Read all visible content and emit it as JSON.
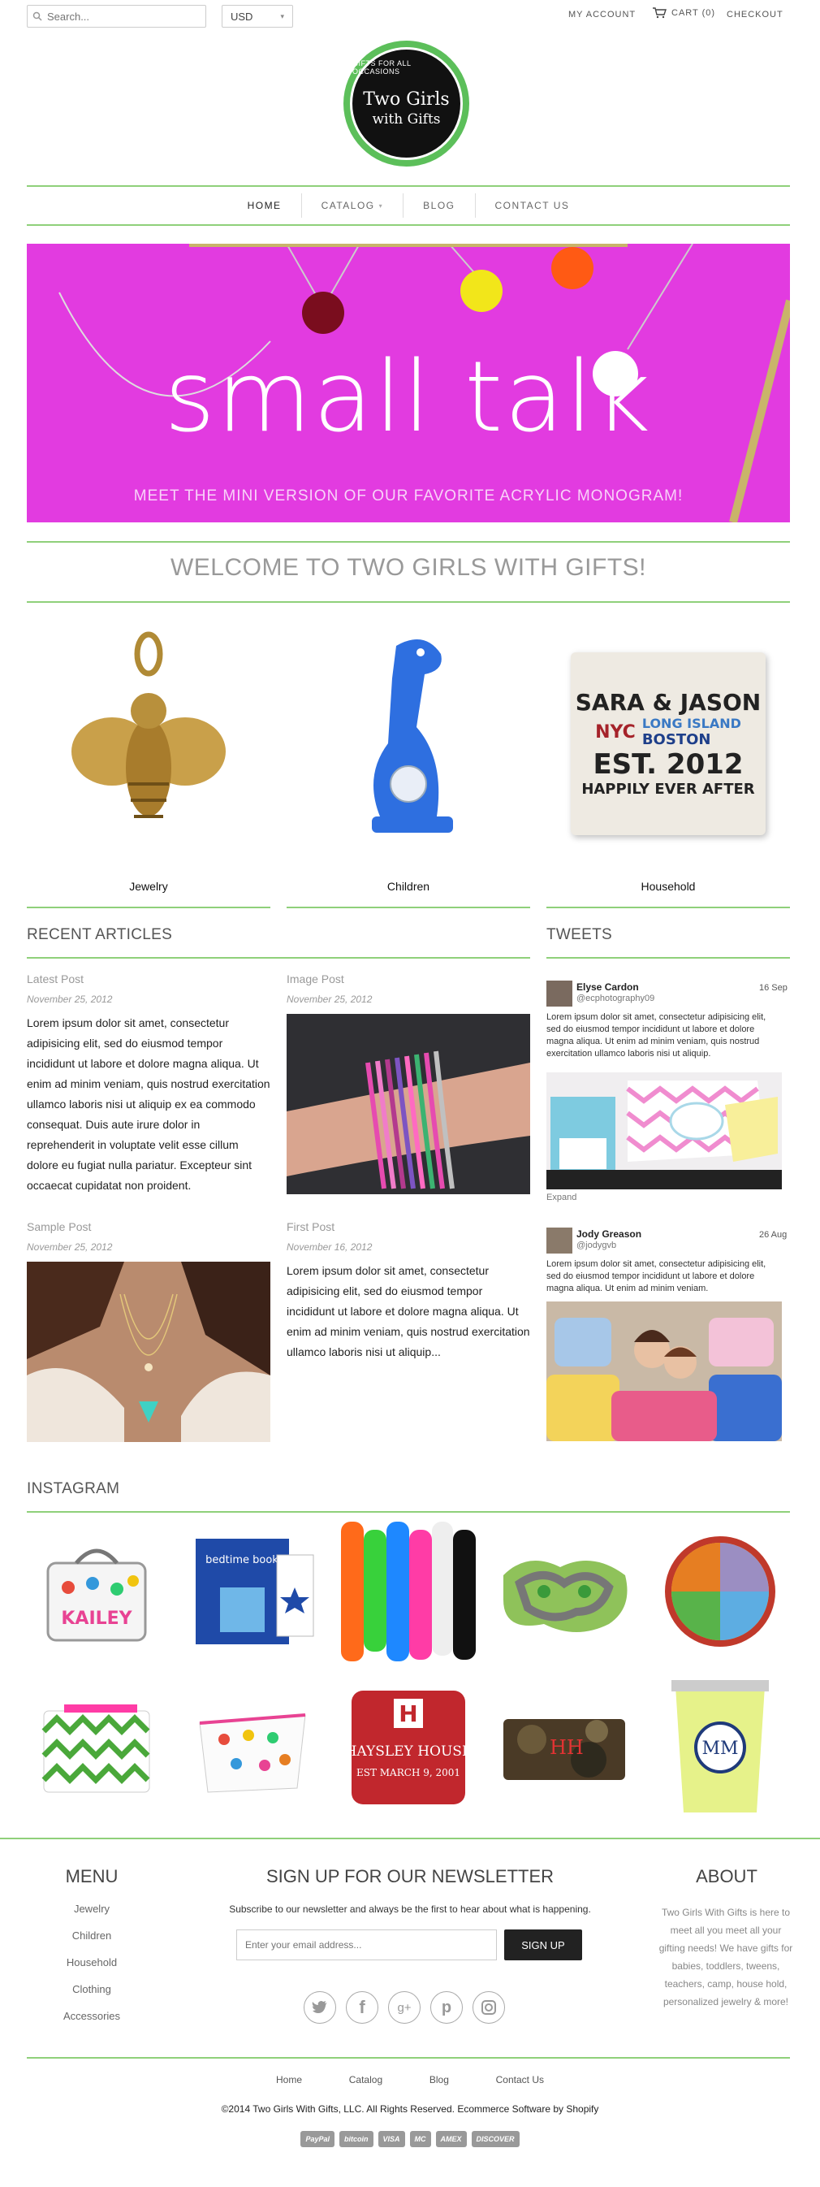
{
  "header": {
    "search_placeholder": "Search...",
    "currency": "USD",
    "my_account": "MY ACCOUNT",
    "cart": "CART (0)",
    "checkout": "CHECKOUT"
  },
  "logo": {
    "tagline": "GIFTS FOR ALL OCCASIONS",
    "name_line1": "Two Girls",
    "name_line2": "with Gifts"
  },
  "nav": {
    "home": "HOME",
    "catalog": "CATALOG",
    "blog": "BLOG",
    "contact": "CONTACT US"
  },
  "hero": {
    "title": "small talk",
    "subtitle": "MEET THE MINI VERSION OF OUR FAVORITE ACRYLIC MONOGRAM!"
  },
  "welcome": "WELCOME TO TWO GIRLS WITH GIFTS!",
  "categories": [
    {
      "label": "Jewelry",
      "icon": "bee-pendant"
    },
    {
      "label": "Children",
      "icon": "blue-giraffe-clock"
    },
    {
      "label": "Household",
      "icon": "pillow"
    }
  ],
  "pillow_text": {
    "l1": "SARA & JASON",
    "l2": "LONG ISLAND",
    "l3": "BOSTON",
    "l4": "EST. 2012",
    "l5": "HAPPILY EVER AFTER",
    "nyc": "NYC"
  },
  "recent_articles": {
    "title": "RECENT ARTICLES",
    "posts": [
      {
        "label": "Latest Post",
        "date": "November 25, 2012",
        "body": "Lorem ipsum dolor sit amet, consectetur adipisicing elit, sed do eiusmod tempor incididunt ut labore et dolore magna aliqua. Ut enim ad minim veniam, quis nostrud exercitation ullamco laboris nisi ut aliquip ex ea commodo consequat. Duis aute irure dolor in reprehenderit in voluptate velit esse cillum dolore eu fugiat nulla pariatur. Excepteur sint occaecat cupidatat non proident."
      },
      {
        "label": "Image Post",
        "date": "November 25, 2012"
      },
      {
        "label": "Sample Post",
        "date": "November 25, 2012"
      },
      {
        "label": "First Post",
        "date": "November 16, 2012",
        "body": "Lorem ipsum dolor sit amet, consectetur adipisicing elit, sed do eiusmod tempor incididunt ut labore et dolore magna aliqua. Ut enim ad minim veniam, quis nostrud exercitation ullamco laboris nisi ut aliquip..."
      }
    ]
  },
  "tweets": {
    "title": "TWEETS",
    "items": [
      {
        "name": "Elyse Cardon",
        "handle": "@ecphotography09",
        "date": "16 Sep",
        "body": "Lorem ipsum dolor sit amet, consectetur adipisicing elit, sed do eiusmod tempor incididunt ut labore et dolore magna aliqua. Ut enim ad minim veniam, quis nostrud exercitation ullamco laboris nisi ut aliquip.",
        "expand": "Expand"
      },
      {
        "name": "Jody Greason",
        "handle": "@jodygvb",
        "date": "26 Aug",
        "body": "Lorem ipsum dolor sit amet, consectetur adipisicing elit, sed do eiusmod tempor incididunt ut labore et dolore magna aliqua. Ut enim ad minim veniam."
      }
    ]
  },
  "instagram": {
    "title": "INSTAGRAM",
    "kailey": "KAILEY",
    "bedtime": "bedtime book",
    "haysley1": "HAYSLEY HOUSE",
    "haysley2": "EST MARCH 9, 2001"
  },
  "footer": {
    "menu_title": "MENU",
    "menu": [
      "Jewelry",
      "Children",
      "Household",
      "Clothing",
      "Accessories"
    ],
    "newsletter_title": "SIGN UP FOR OUR NEWSLETTER",
    "newsletter_text": "Subscribe to our newsletter and always be the first to hear about what is happening.",
    "email_placeholder": "Enter your email address...",
    "signup": "SIGN UP",
    "about_title": "ABOUT",
    "about_text": "Two Girls With Gifts is here to meet all you meet all your gifting needs! We have gifts for babies, toddlers, tweens, teachers, camp, house hold, personalized jewelry & more!",
    "links": [
      "Home",
      "Catalog",
      "Blog",
      "Contact Us"
    ],
    "copyright": "©2014 Two Girls With Gifts, LLC. All Rights Reserved. Ecommerce Software by Shopify",
    "payments": [
      "PayPal",
      "bitcoin",
      "VISA",
      "MC",
      "AMEX",
      "DISCOVER"
    ]
  },
  "colors": {
    "accent_green": "#8fd07a",
    "hero_pink": "#e23be0",
    "logo_green": "#5cbf5a"
  }
}
